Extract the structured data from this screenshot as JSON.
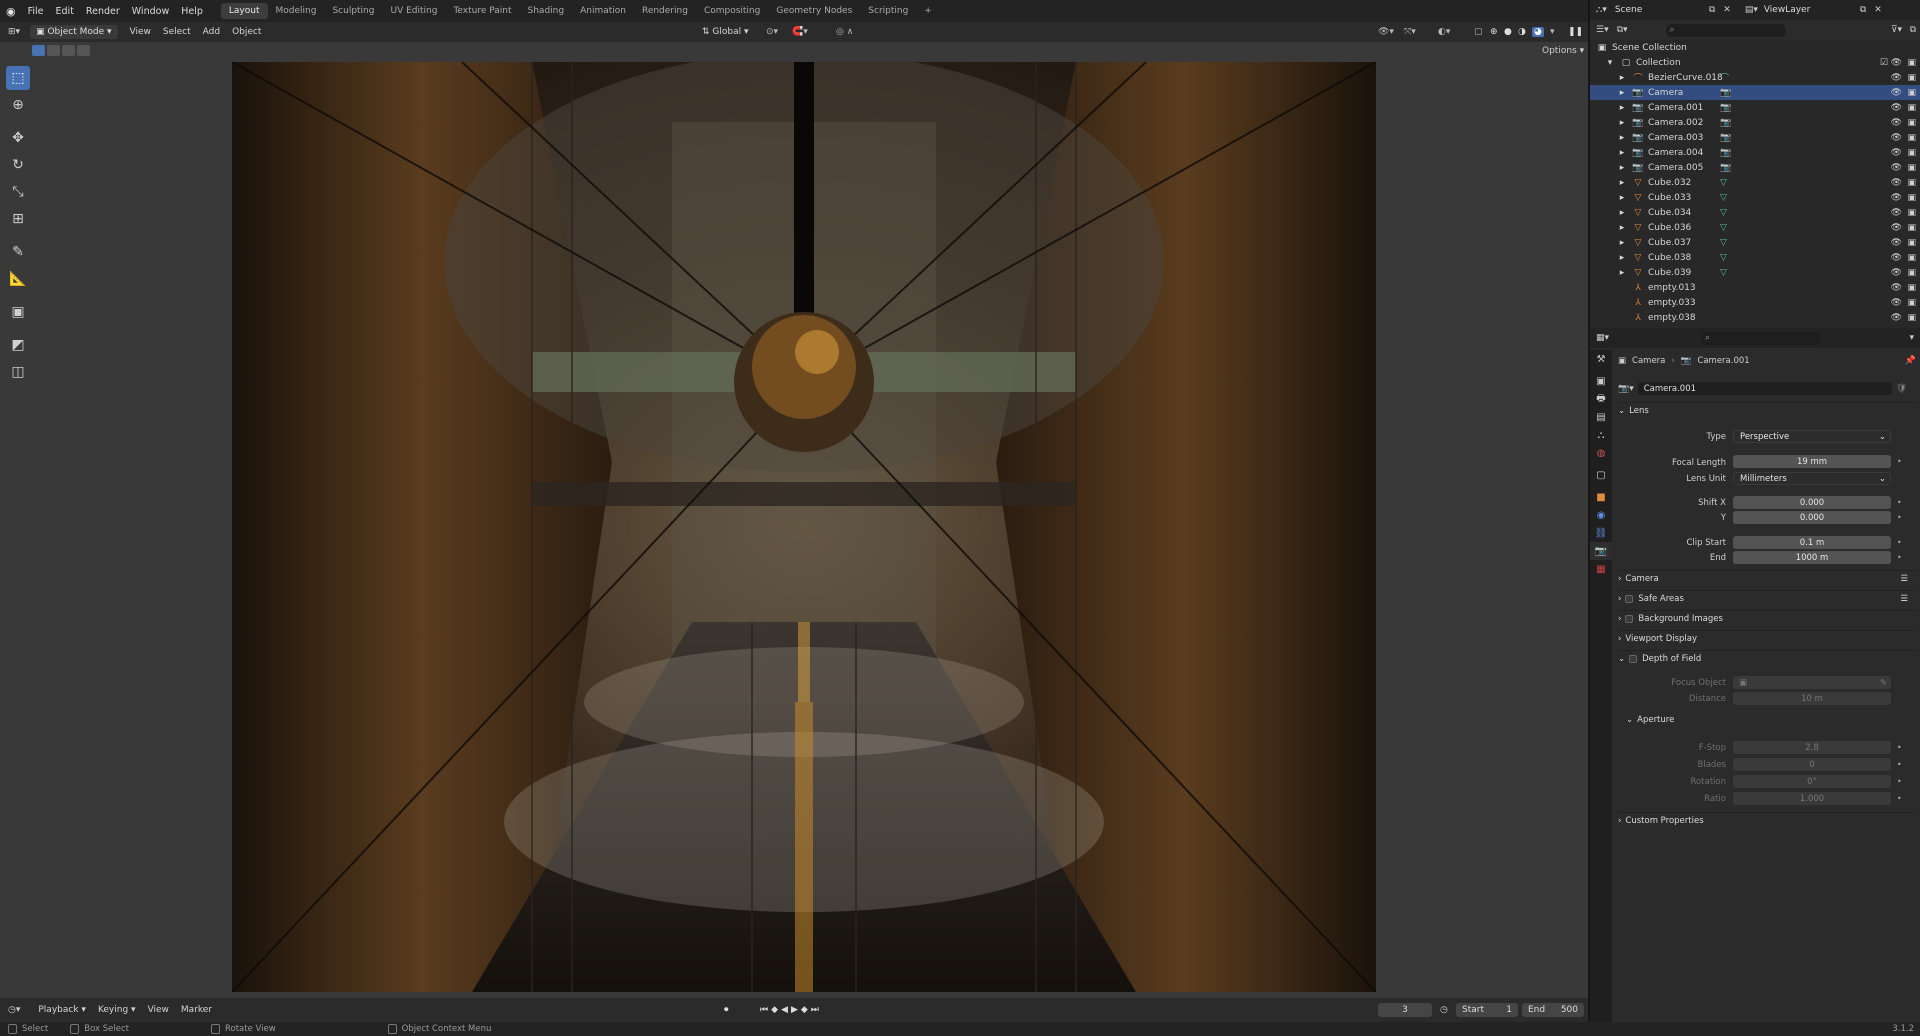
{
  "menu": {
    "file": "File",
    "edit": "Edit",
    "render": "Render",
    "window": "Window",
    "help": "Help"
  },
  "workspaces": [
    "Layout",
    "Modeling",
    "Sculpting",
    "UV Editing",
    "Texture Paint",
    "Shading",
    "Animation",
    "Rendering",
    "Compositing",
    "Geometry Nodes",
    "Scripting"
  ],
  "header": {
    "mode": "Object Mode",
    "view": "View",
    "select": "Select",
    "add": "Add",
    "object": "Object",
    "orientation": "Global",
    "options": "Options"
  },
  "scene": {
    "name": "Scene",
    "view_layer": "ViewLayer"
  },
  "outliner": {
    "root": "Scene Collection",
    "collection": "Collection",
    "items": [
      {
        "name": "BezierCurve.018",
        "icon": "curve-icon"
      },
      {
        "name": "Camera",
        "icon": "camera-icon",
        "selected": true
      },
      {
        "name": "Camera.001",
        "icon": "camera-icon"
      },
      {
        "name": "Camera.002",
        "icon": "camera-icon"
      },
      {
        "name": "Camera.003",
        "icon": "camera-icon"
      },
      {
        "name": "Camera.004",
        "icon": "camera-icon"
      },
      {
        "name": "Camera.005",
        "icon": "camera-icon"
      },
      {
        "name": "Cube.032",
        "icon": "mesh-icon"
      },
      {
        "name": "Cube.033",
        "icon": "mesh-icon"
      },
      {
        "name": "Cube.034",
        "icon": "mesh-icon"
      },
      {
        "name": "Cube.036",
        "icon": "mesh-icon"
      },
      {
        "name": "Cube.037",
        "icon": "mesh-icon"
      },
      {
        "name": "Cube.038",
        "icon": "mesh-icon"
      },
      {
        "name": "Cube.039",
        "icon": "mesh-icon"
      },
      {
        "name": "empty.013",
        "icon": "empty-icon"
      },
      {
        "name": "empty.033",
        "icon": "empty-icon"
      },
      {
        "name": "empty.038",
        "icon": "empty-icon"
      }
    ]
  },
  "properties": {
    "breadcrumb_object": "Camera",
    "breadcrumb_data": "Camera.001",
    "datablock": "Camera.001",
    "lens_panel": "Lens",
    "type_label": "Type",
    "type_value": "Perspective",
    "focal_label": "Focal Length",
    "focal_value": "19 mm",
    "lens_unit_label": "Lens Unit",
    "lens_unit_value": "Millimeters",
    "shift_x_label": "Shift X",
    "shift_x_value": "0.000",
    "shift_y_label": "Y",
    "shift_y_value": "0.000",
    "clip_start_label": "Clip Start",
    "clip_start_value": "0.1 m",
    "clip_end_label": "End",
    "clip_end_value": "1000 m",
    "camera_panel": "Camera",
    "safe_areas_panel": "Safe Areas",
    "background_panel": "Background Images",
    "viewport_display_panel": "Viewport Display",
    "dof_panel": "Depth of Field",
    "focus_object_label": "Focus Object",
    "distance_label": "Distance",
    "distance_value": "10 m",
    "aperture_panel": "Aperture",
    "fstop_label": "F-Stop",
    "fstop_value": "2.8",
    "blades_label": "Blades",
    "blades_value": "0",
    "rotation_label": "Rotation",
    "rotation_value": "0°",
    "ratio_label": "Ratio",
    "ratio_value": "1.000",
    "custom_panel": "Custom Properties"
  },
  "timeline": {
    "playback": "Playback",
    "keying": "Keying",
    "view": "View",
    "marker": "Marker",
    "current_frame": "3",
    "start_label": "Start",
    "start_value": "1",
    "end_label": "End",
    "end_value": "500"
  },
  "status": {
    "select": "Select",
    "box_select": "Box Select",
    "rotate_view": "Rotate View",
    "context_menu": "Object Context Menu",
    "version": "3.1.2"
  }
}
